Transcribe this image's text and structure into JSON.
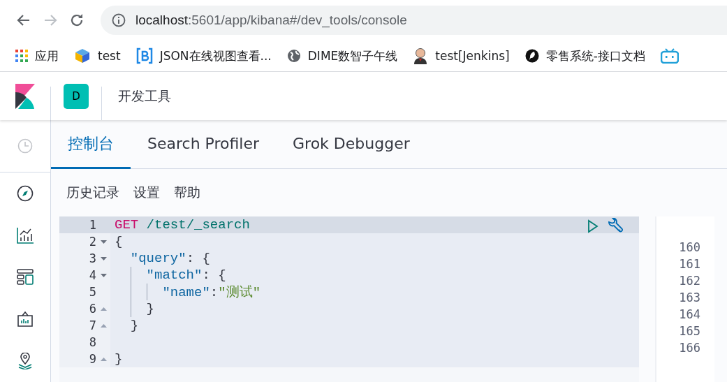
{
  "browser": {
    "nav": [
      {
        "kind": "back",
        "disabled": false
      },
      {
        "kind": "forward",
        "disabled": true
      },
      {
        "kind": "reload",
        "disabled": false
      }
    ],
    "url": {
      "host": "localhost",
      "path": ":5601/app/kibana#/dev_tools/console"
    },
    "bookmarks": [
      {
        "kind": "apps",
        "label": "应用"
      },
      {
        "kind": "cube",
        "label": "test"
      },
      {
        "kind": "bracket",
        "label": "JSON在线视图查看..."
      },
      {
        "kind": "globe",
        "label": "DIME数智子午线"
      },
      {
        "kind": "person",
        "label": "test[Jenkins]"
      },
      {
        "kind": "feather",
        "label": "零售系统-接口文档"
      },
      {
        "kind": "tv"
      }
    ]
  },
  "header": {
    "space_initial": "D",
    "title": "开发工具"
  },
  "sidebar": [
    {
      "kind": "clock"
    },
    {
      "kind": "compass"
    },
    {
      "kind": "chart"
    },
    {
      "kind": "dashboard"
    },
    {
      "kind": "canvas"
    },
    {
      "kind": "maps"
    }
  ],
  "tabs": [
    {
      "label": "控制台",
      "selected": true
    },
    {
      "label": "Search Profiler",
      "selected": false
    },
    {
      "label": "Grok Debugger",
      "selected": false
    }
  ],
  "menu": [
    "历史记录",
    "设置",
    "帮助"
  ],
  "editor": {
    "lines": [
      {
        "number": "1",
        "kind": "plain",
        "active": true,
        "tokens": [
          {
            "text": "GET",
            "kind": "method"
          },
          {
            "text": " /test/_search",
            "kind": "url"
          }
        ]
      },
      {
        "number": "2",
        "kind": "fold-start",
        "active": false,
        "tokens": [
          {
            "text": "{",
            "kind": "punct"
          }
        ]
      },
      {
        "number": "3",
        "kind": "fold-start",
        "active": false,
        "tokens": [
          {
            "text": "  \"query\"",
            "kind": "key"
          },
          {
            "text": ": {",
            "kind": "punct"
          }
        ]
      },
      {
        "number": "4",
        "kind": "fold-start",
        "active": false,
        "tokens": [
          {
            "text": "    \"match\"",
            "kind": "key"
          },
          {
            "text": ": {",
            "kind": "punct"
          }
        ]
      },
      {
        "number": "5",
        "kind": "plain",
        "active": false,
        "tokens": [
          {
            "text": "      \"name\"",
            "kind": "key"
          },
          {
            "text": ":",
            "kind": "punct"
          },
          {
            "text": "\"测试\"",
            "kind": "string"
          }
        ]
      },
      {
        "number": "6",
        "kind": "fold-end",
        "active": false,
        "tokens": [
          {
            "text": "    }",
            "kind": "punct"
          }
        ]
      },
      {
        "number": "7",
        "kind": "fold-end",
        "active": false,
        "tokens": [
          {
            "text": "  }",
            "kind": "punct"
          }
        ]
      },
      {
        "number": "8",
        "kind": "plain",
        "active": false
      },
      {
        "number": "9",
        "kind": "fold-end",
        "active": false,
        "tokens": [
          {
            "text": "}",
            "kind": "punct"
          }
        ]
      }
    ]
  },
  "output": {
    "lines": [
      "160",
      "161",
      "162",
      "163",
      "164",
      "165",
      "166"
    ]
  }
}
